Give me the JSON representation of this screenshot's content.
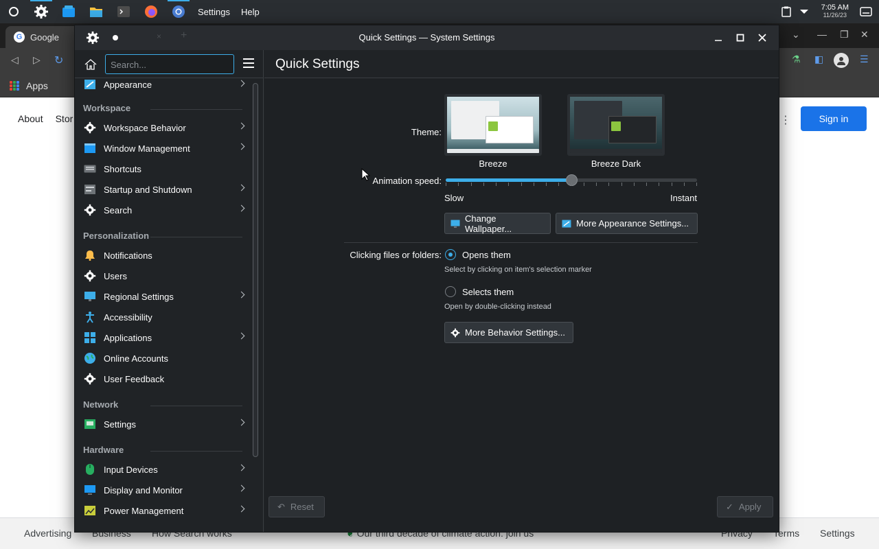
{
  "panel": {
    "menu_items": [
      "Settings",
      "Help"
    ],
    "clock_time": "7:05 AM",
    "clock_date": "11/26/23"
  },
  "browser": {
    "tab_title": "Google",
    "bookmarks_apps": "Apps",
    "nav_links": [
      "About",
      "Stor"
    ],
    "sign_in": "Sign in",
    "footer": {
      "advertising": "Advertising",
      "business": "Business",
      "how_search": "How Search works",
      "climate": "Our third decade of climate action: join us",
      "privacy": "Privacy",
      "terms": "Terms",
      "settings": "Settings"
    }
  },
  "window": {
    "title": "Quick Settings — System Settings",
    "search_placeholder": "Search...",
    "page_title": "Quick Settings",
    "sidebar": {
      "appearance": "Appearance",
      "cat_workspace": "Workspace",
      "workspace_behavior": "Workspace Behavior",
      "window_management": "Window Management",
      "shortcuts": "Shortcuts",
      "startup_shutdown": "Startup and Shutdown",
      "search": "Search",
      "cat_personalization": "Personalization",
      "notifications": "Notifications",
      "users": "Users",
      "regional_settings": "Regional Settings",
      "accessibility": "Accessibility",
      "applications": "Applications",
      "online_accounts": "Online Accounts",
      "user_feedback": "User Feedback",
      "cat_network": "Network",
      "network_settings": "Settings",
      "cat_hardware": "Hardware",
      "input_devices": "Input Devices",
      "display_monitor": "Display and Monitor",
      "power_management": "Power Management"
    },
    "quick": {
      "theme_label": "Theme:",
      "theme_light": "Breeze",
      "theme_dark": "Breeze Dark",
      "animation_label": "Animation speed:",
      "slow": "Slow",
      "instant": "Instant",
      "animation_value_fraction": 0.5,
      "change_wallpaper": "Change Wallpaper...",
      "more_appearance": "More Appearance Settings...",
      "clicking_label": "Clicking files or folders:",
      "opens_them": "Opens them",
      "opens_note": "Select by clicking on item's selection marker",
      "selects_them": "Selects them",
      "selects_note": "Open by double-clicking instead",
      "more_behavior": "More Behavior Settings...",
      "reset": "Reset",
      "apply": "Apply"
    }
  },
  "colors": {
    "accent": "#3daee9",
    "window_bg": "#202326",
    "panel_bg": "#2a2e32"
  }
}
